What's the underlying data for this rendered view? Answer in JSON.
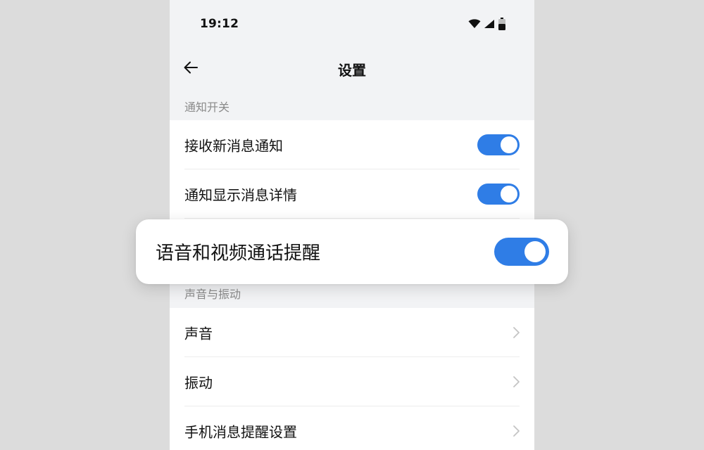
{
  "status_bar": {
    "time": "19:12",
    "icons": [
      "wifi-icon",
      "signal-icon",
      "battery-icon"
    ]
  },
  "nav": {
    "title": "设置",
    "back_icon": "arrow-left-icon"
  },
  "sections": {
    "notification": {
      "header": "通知开关",
      "items": [
        {
          "label": "接收新消息通知",
          "on": true
        },
        {
          "label": "通知显示消息详情",
          "on": true
        }
      ]
    },
    "sound": {
      "header": "声音与振动",
      "items": [
        {
          "label": "声音"
        },
        {
          "label": "振动"
        },
        {
          "label": "手机消息提醒设置"
        }
      ]
    }
  },
  "popup": {
    "label": "语音和视频通话提醒",
    "on": true
  },
  "colors": {
    "accent": "#2f7de6",
    "page_bg": "#f2f3f5",
    "outer_bg": "#dcdcdc",
    "section_text": "#8a8a8a"
  }
}
